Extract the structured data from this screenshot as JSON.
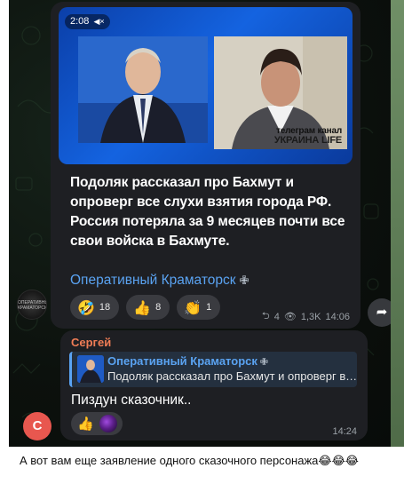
{
  "video": {
    "duration": "2:08",
    "mute_icon": "speaker-muted-icon",
    "watermark_line1": "телеграм канал",
    "watermark_line2": "УКРАИНА LIFE"
  },
  "post": {
    "text": "Подоляк рассказал про Бахмут и опроверг все слухи взятия города РФ. Россия потеряла за 9 месяцев почти все свои войска в Бахмуте.",
    "signature": "Оперативный Краматорск",
    "signature_icon": "✙",
    "channel_avatar_text": "ОПЕРАТИВНЫЙ КРАМАТОРСК",
    "reactions": [
      {
        "emoji": "🤣",
        "count": "18"
      },
      {
        "emoji": "👍",
        "count": "8"
      },
      {
        "emoji": "👏",
        "count": "1"
      }
    ],
    "forwards_icon": "⮌",
    "forwards": "4",
    "views_icon": "👁",
    "views": "1,3K",
    "time": "14:06",
    "share_icon": "➦"
  },
  "reply": {
    "author": "Сергей",
    "quote_title": "Оперативный Краматорск",
    "quote_title_icon": "✙",
    "quote_text": "Подоляк рассказал про Бахмут и опроверг все слухи взятия города РФ.",
    "text": "Пиздун сказочник..",
    "reaction_emoji": "👍",
    "time": "14:24",
    "avatar_letter": "С"
  },
  "caption": {
    "text": "А вот вам еще заявление одного сказочного персонажа",
    "emojis": "😂😂😂"
  },
  "colors": {
    "accent_blue": "#5aa3f2",
    "author_orange": "#f07d56",
    "bubble": "#1e1f23",
    "avatar_red": "#e8574f"
  }
}
